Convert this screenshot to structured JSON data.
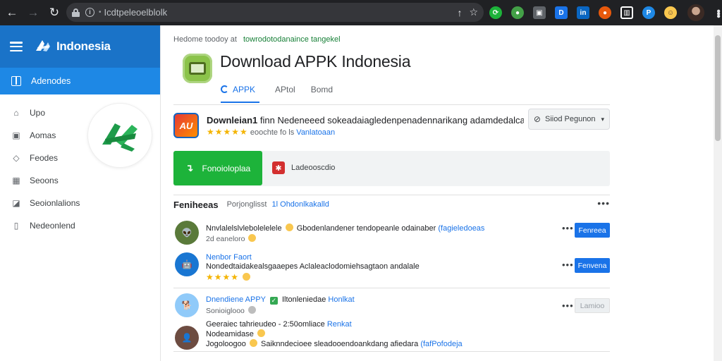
{
  "browser": {
    "url": "Icdtpeleoelblolk",
    "nav": {
      "back": "←",
      "forward": "→",
      "reload": "↻"
    },
    "extensions": [
      {
        "name": "green-refresh-icon",
        "color": "#1db33a",
        "glyph": "⟳"
      },
      {
        "name": "colorful-globe-icon",
        "color": "#43a047",
        "glyph": "●"
      },
      {
        "name": "puzzle-icon",
        "color": "#5f6368",
        "glyph": "▣"
      },
      {
        "name": "blue-d-icon",
        "color": "#1a73e8",
        "glyph": "D"
      },
      {
        "name": "linkedin-icon",
        "color": "#0a66c2",
        "glyph": "in"
      },
      {
        "name": "orange-circle-icon",
        "color": "#e8590c",
        "glyph": "●"
      },
      {
        "name": "reader-icon",
        "color": "#ffffff",
        "glyph": "▥"
      },
      {
        "name": "blue-p-icon",
        "color": "#1e88e5",
        "glyph": "P"
      },
      {
        "name": "smiley-icon",
        "color": "#f9c74f",
        "glyph": "☺"
      }
    ]
  },
  "sidebar": {
    "brand": "Indonesia",
    "active_item": "Adenodes",
    "items": [
      {
        "label": "Upo",
        "icon": "home-icon",
        "glyph": "⌂"
      },
      {
        "label": "Aomas",
        "icon": "image-icon",
        "glyph": "▣"
      },
      {
        "label": "Feodes",
        "icon": "tag-icon",
        "glyph": "◇"
      },
      {
        "label": "Seoons",
        "icon": "grid-icon",
        "glyph": "▦"
      },
      {
        "label": "Seoionlalions",
        "icon": "chart-icon",
        "glyph": "◪"
      },
      {
        "label": "Nedeonlend",
        "icon": "phone-icon",
        "glyph": "▯"
      }
    ]
  },
  "header": {
    "crumb_prefix": "Hedome toodoy at",
    "crumb_link": "towrodotodanaince tangekel",
    "title": "Download APPK Indonesia",
    "tabs": [
      "APPK",
      "APtol",
      "Bomd"
    ]
  },
  "summary": {
    "icon_text": "AU",
    "title_bold": "Downleian1",
    "title_rest": "finn Nedeneeed sokeadaiagledenpenadennarikang adamdedalcar.",
    "rating": "★★★★★",
    "meta": "eoochte fo  ls",
    "meta_link": "Vanlatoaan",
    "share_label": "Siiod Pegunon"
  },
  "actions": {
    "download_label": "Fonoioloplaa",
    "report_label": "Ladeooscdio"
  },
  "section": {
    "title": "Feniheeas",
    "subtitle": "Porjonglisst",
    "subtitle_link": "1l Ohdonlkakalld"
  },
  "rows": [
    {
      "avatar": "green-alien-avatar",
      "avatar_color": "#5a7a3a",
      "name": "Nnvlalelslvlebolelelele",
      "text": "Gbodenlandener tendopeanle odainaber",
      "link": "(fagieledoeas",
      "sub": "2d eaneloro",
      "stars": "",
      "button": "Fenreea",
      "button_style": "primary"
    },
    {
      "avatar": "red-robot-avatar",
      "avatar_color": "#e53935",
      "name": "Nenbor Faort",
      "text": "Nondedtaidakealsgaaepes Aclaleaclodomiehsagtaon andalale",
      "link": "",
      "sub": "",
      "stars": "★★★★",
      "button": "Fenvena",
      "button_style": "primary"
    },
    {
      "avatar": "dog-avatar",
      "avatar_color": "#90caf9",
      "name": "Dnendiene APPY",
      "text": "Iltonleniedae",
      "link": "Honlkat",
      "sub": "Sonioiglooo",
      "stars": "",
      "button": "Lamioo",
      "button_style": "muted"
    },
    {
      "avatar": "person-avatar",
      "avatar_color": "#6d4c41",
      "name": "",
      "text": "Geeraiec tahrieudeo - 2:50omliace",
      "link": "Renkat",
      "sub": "Nodeamidase",
      "text2": "Jogoloogoo",
      "text2_rest": "Saiknndecioee sleadooendoankdang afiedara",
      "link2": "(fafPofodeja",
      "stars": "",
      "button": "",
      "button_style": ""
    }
  ]
}
